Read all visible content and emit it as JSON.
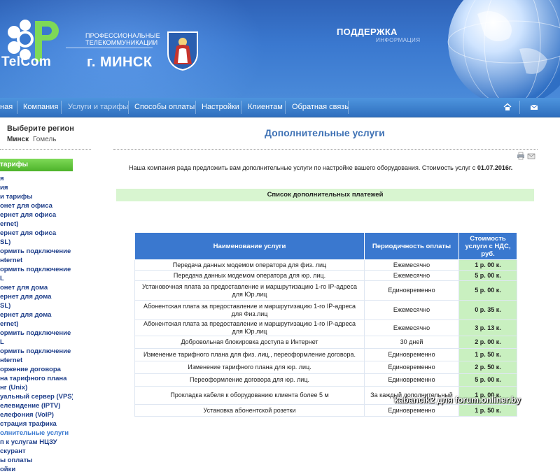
{
  "header": {
    "logo_text": "TelCom",
    "tagline_1": "ПРОФЕССИОНАЛЬНЫЕ",
    "tagline_2": "ТЕЛЕКОММУНИКАЦИИ",
    "city": "г. МИНСК",
    "support_title": "ПОДДЕРЖКА",
    "support_subtitle": "ИНФОРМАЦИЯ"
  },
  "nav": {
    "items": [
      {
        "label": "ная"
      },
      {
        "label": "Компания"
      },
      {
        "label": "Услуги и тарифы"
      },
      {
        "label": "Способы оплаты"
      },
      {
        "label": "Настройки"
      },
      {
        "label": "Клиентам"
      },
      {
        "label": "Обратная связь"
      }
    ],
    "home_icon": "home-icon",
    "mail_icon": "mail-icon"
  },
  "sidebar": {
    "region_title": "Выберите регион",
    "region_selected": "Минск",
    "region_other": "Гомель",
    "tariffs_heading": "тарифы",
    "menu": [
      "я",
      "ия",
      "и тарифы",
      "онет для офиса",
      "ернет для офиса",
      "ernet)",
      "ернет для офиса",
      "SL)",
      "ормить подключение",
      "нternet",
      "ормить подключение",
      "L",
      "онет для дома",
      "ернет для дома",
      "SL)",
      "ернет для дома",
      "ernet)",
      "ормить подключение",
      "L",
      "ормить подключение",
      "нternet",
      "оржение договора",
      "на тарифного плана",
      "нг (Unix)",
      "уальный сервер (VPS)",
      "елевидение (IPTV)",
      "елефония (VoIP)",
      "страция трафика",
      "олнительные услуги",
      "п к услугам НЦЗУ",
      "скурант",
      "ы оплаты",
      "ойки"
    ],
    "active_index": 28
  },
  "main": {
    "title": "Дополнительные услуги",
    "intro_text": "Наша компания рада предложить вам дополнительные услуги по настройке вашего оборудования. Стоимость услуг с ",
    "intro_date": "01.07.2016г.",
    "list_title": "Список дополнительных платежей",
    "table": {
      "headers": [
        "Наименование услуги",
        "Периодичность оплаты",
        "Стоимость услуги с НДС, руб."
      ],
      "rows": [
        [
          "Передача данных модемом оператора для физ. лиц",
          "Ежемесячно",
          "1 р. 00 к."
        ],
        [
          "Передача данных модемом оператора для юр. лиц.",
          "Ежемесячно",
          "5 р. 00 к."
        ],
        [
          "Установочная плата за предоставление и маршрутизацию 1-го IP-адреса для Юр.лиц",
          "Единовременно",
          "5 р. 00 к."
        ],
        [
          "Абонентская плата за предоставление и маршрутизацию 1-го IP-адреса для Физ.лиц",
          "Ежемесячно",
          "0 р. 35 к."
        ],
        [
          "Абонентская плата за предоставление и маршрутизацию 1-го IP-адреса для Юр.лиц",
          "Ежемесячно",
          "3 р. 13 к."
        ],
        [
          "Добровольная блокировка доступа в Интернет",
          "30 дней",
          "2 р. 00 к."
        ],
        [
          "Изменение тарифного плана для физ. лиц., переоформление договора.",
          "Единовременно",
          "1 р. 50 к."
        ],
        [
          "Изменение тарифного плана для юр. лиц.",
          "Единовременно",
          "2 р. 50 к."
        ],
        [
          "Переоформление договора для юр. лиц.",
          "Единовременно",
          "5 р. 00 к."
        ],
        [
          "Прокладка кабеля к оборудованию клиента более 5 м",
          "За каждый дополнительный",
          "1 р. 00 к."
        ],
        [
          "Установка абонентской розетки",
          "Единовременно",
          "1 р. 50 к."
        ]
      ]
    }
  },
  "watermark": "kabancik2 для forum.onliner.by",
  "colors": {
    "header_blue": "#3a78cf",
    "menu_link": "#1f3f8a",
    "price_green": "#c9f0c0",
    "tariff_green": "#4db32a"
  }
}
